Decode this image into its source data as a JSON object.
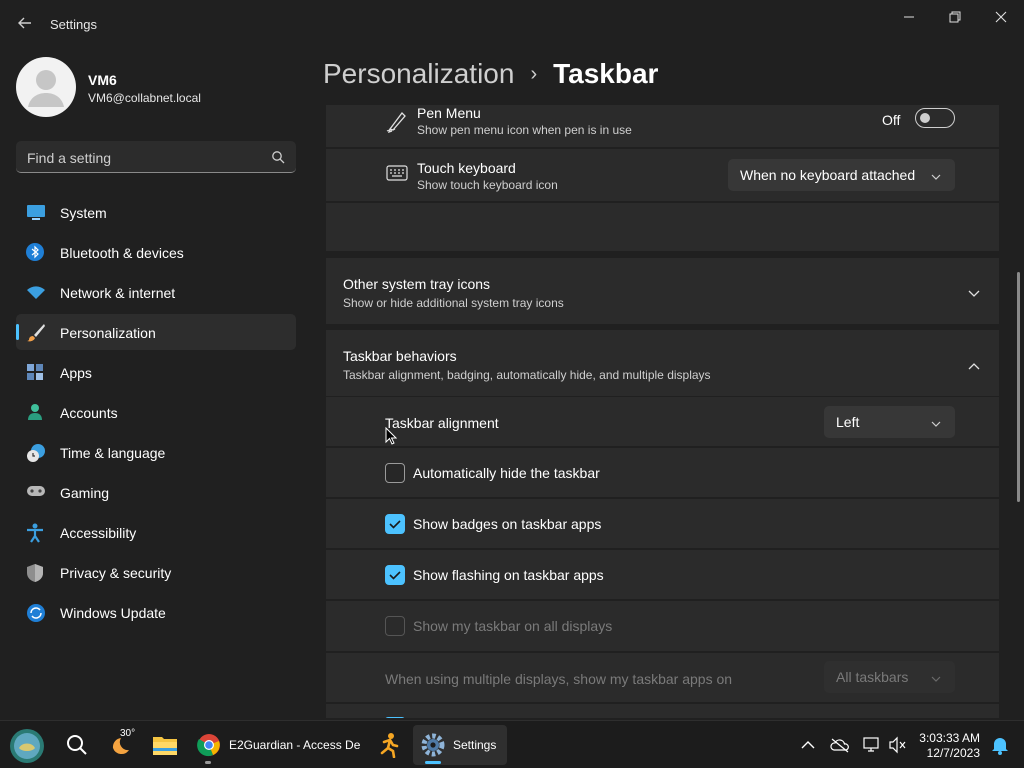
{
  "window": {
    "title": "Settings"
  },
  "user": {
    "name": "VM6",
    "email": "VM6@collabnet.local"
  },
  "search": {
    "placeholder": "Find a setting"
  },
  "sidebar": {
    "items": [
      {
        "label": "System",
        "icon": "system-icon"
      },
      {
        "label": "Bluetooth & devices",
        "icon": "bluetooth-icon"
      },
      {
        "label": "Network & internet",
        "icon": "wifi-icon"
      },
      {
        "label": "Personalization",
        "icon": "brush-icon",
        "active": true
      },
      {
        "label": "Apps",
        "icon": "apps-icon"
      },
      {
        "label": "Accounts",
        "icon": "accounts-icon"
      },
      {
        "label": "Time & language",
        "icon": "clock-globe-icon"
      },
      {
        "label": "Gaming",
        "icon": "gamepad-icon"
      },
      {
        "label": "Accessibility",
        "icon": "accessibility-icon"
      },
      {
        "label": "Privacy & security",
        "icon": "shield-icon"
      },
      {
        "label": "Windows Update",
        "icon": "update-icon"
      }
    ]
  },
  "breadcrumb": {
    "parent": "Personalization",
    "separator": "›",
    "current": "Taskbar"
  },
  "pen_menu": {
    "title": "Pen Menu",
    "subtitle": "Show pen menu icon when pen is in use",
    "state": "Off"
  },
  "touch_keyboard": {
    "title": "Touch keyboard",
    "subtitle": "Show touch keyboard icon",
    "value": "When no keyboard attached"
  },
  "other_tray": {
    "title": "Other system tray icons",
    "subtitle": "Show or hide additional system tray icons"
  },
  "behaviors": {
    "title": "Taskbar behaviors",
    "subtitle": "Taskbar alignment, badging, automatically hide, and multiple displays",
    "alignment_label": "Taskbar alignment",
    "alignment_value": "Left",
    "auto_hide": {
      "label": "Automatically hide the taskbar",
      "checked": false
    },
    "badges": {
      "label": "Show badges on taskbar apps",
      "checked": true
    },
    "flashing": {
      "label": "Show flashing on taskbar apps",
      "checked": true
    },
    "all_displays": {
      "label": "Show my taskbar on all displays",
      "checked": false,
      "disabled": true
    },
    "multi_display_label": "When using multiple displays, show my taskbar apps on",
    "multi_display_value": "All taskbars"
  },
  "taskbar": {
    "weather_temp": "30°",
    "chrome_label": "E2Guardian - Access De",
    "settings_label": "Settings",
    "time": "3:03:33 AM",
    "date": "12/7/2023"
  },
  "colors": {
    "accent": "#4cc2ff",
    "background": "#202020",
    "card": "#2b2b2b"
  }
}
